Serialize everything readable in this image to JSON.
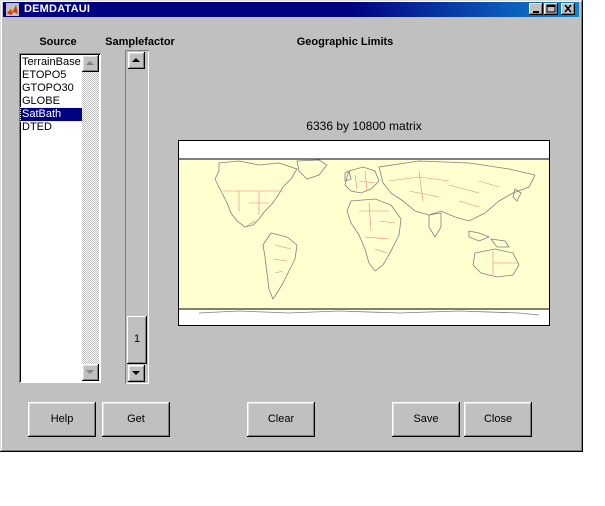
{
  "window": {
    "title": "DEMDATAUI",
    "controls": {
      "minimize": "_",
      "maximize": "□",
      "close": "×"
    }
  },
  "labels": {
    "source": "Source",
    "samplefactor": "Samplefactor",
    "geographic_limits": "Geographic Limits"
  },
  "source_list": {
    "items": [
      "TerrainBase",
      "ETOPO5",
      "GTOPO30",
      "GLOBE",
      "SatBath",
      "DTED"
    ],
    "selected": "SatBath"
  },
  "samplefactor": {
    "value": "1",
    "level": 1.0
  },
  "map": {
    "caption": "6336 by 10800 matrix",
    "colors": {
      "land": "#ffffd0",
      "ocean": "#ffffff",
      "coast": "#808080",
      "borders": "#f08080"
    }
  },
  "buttons": {
    "help": "Help",
    "get": "Get",
    "clear": "Clear",
    "save": "Save",
    "close": "Close"
  },
  "icons": {
    "title_icon": "matlab-icon",
    "scroll_up": "arrow-up-icon",
    "scroll_down": "arrow-down-icon"
  }
}
